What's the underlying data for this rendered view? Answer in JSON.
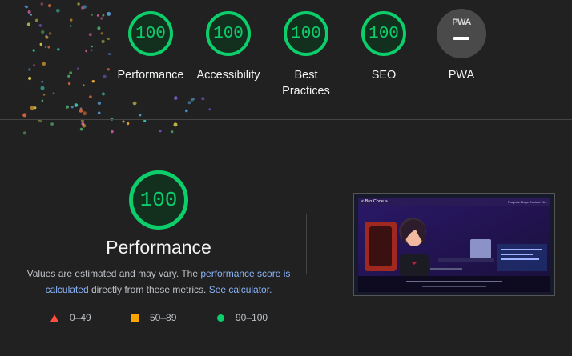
{
  "categories": [
    {
      "score": "100",
      "label": "Performance"
    },
    {
      "score": "100",
      "label": "Accessibility"
    },
    {
      "score": "100",
      "label": "Best Practices"
    },
    {
      "score": "100",
      "label": "SEO"
    }
  ],
  "pwa": {
    "badge": "PWA",
    "label": "PWA"
  },
  "performance": {
    "score": "100",
    "title": "Performance",
    "desc_prefix": "Values are estimated and may vary. The ",
    "link1": "performance score is calculated",
    "desc_middle": " directly from these metrics. ",
    "link2": "See calculator."
  },
  "legend": {
    "fail": "0–49",
    "average": "50–89",
    "pass": "90–100"
  },
  "screenshot": {
    "site_name": "< Bro Code >",
    "nav_links": "Projects  Blogs  Contact  Hire"
  },
  "colors": {
    "pass": "#0cce6b",
    "average": "#ffa400",
    "fail": "#ff4e42",
    "background": "#212121"
  }
}
